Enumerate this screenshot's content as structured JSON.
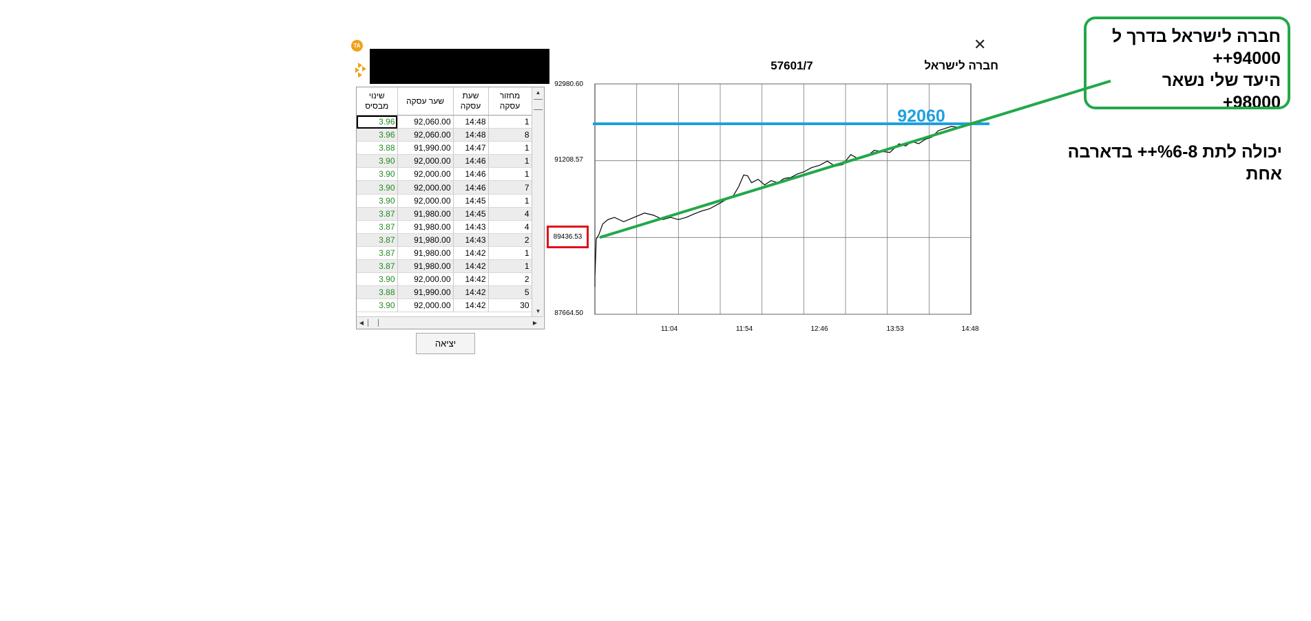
{
  "header": {
    "logo_text": "TA",
    "security_number": "57601/7",
    "security_name": "חברה לישראל",
    "close_symbol": "✕"
  },
  "table": {
    "columns": [
      "מחזור עסקה",
      "שעת עסקה",
      "שער עסקה",
      "שינוי מבסיס"
    ],
    "rows": [
      {
        "volume": "1",
        "time": "14:48",
        "price": "92,060.00",
        "change": "3.96"
      },
      {
        "volume": "8",
        "time": "14:48",
        "price": "92,060.00",
        "change": "3.96"
      },
      {
        "volume": "1",
        "time": "14:47",
        "price": "91,990.00",
        "change": "3.88"
      },
      {
        "volume": "1",
        "time": "14:46",
        "price": "92,000.00",
        "change": "3.90"
      },
      {
        "volume": "1",
        "time": "14:46",
        "price": "92,000.00",
        "change": "3.90"
      },
      {
        "volume": "7",
        "time": "14:46",
        "price": "92,000.00",
        "change": "3.90"
      },
      {
        "volume": "1",
        "time": "14:45",
        "price": "92,000.00",
        "change": "3.90"
      },
      {
        "volume": "4",
        "time": "14:45",
        "price": "91,980.00",
        "change": "3.87"
      },
      {
        "volume": "4",
        "time": "14:43",
        "price": "91,980.00",
        "change": "3.87"
      },
      {
        "volume": "2",
        "time": "14:43",
        "price": "91,980.00",
        "change": "3.87"
      },
      {
        "volume": "1",
        "time": "14:42",
        "price": "91,980.00",
        "change": "3.87"
      },
      {
        "volume": "1",
        "time": "14:42",
        "price": "91,980.00",
        "change": "3.87"
      },
      {
        "volume": "2",
        "time": "14:42",
        "price": "92,000.00",
        "change": "3.90"
      },
      {
        "volume": "5",
        "time": "14:42",
        "price": "91,990.00",
        "change": "3.88"
      },
      {
        "volume": "30",
        "time": "14:42",
        "price": "92,000.00",
        "change": "3.90"
      }
    ],
    "exit_label": "יציאה"
  },
  "annotations": {
    "box_lines": [
      "חברה לישראל בדרך ל",
      "94000++",
      "היעד שלי נשאר",
      "98000+"
    ],
    "note_lines": [
      "יכולה לתת %6-8++ בדארבה",
      "אחת"
    ],
    "blue_label": "92060",
    "colors": {
      "green": "#22a84a",
      "blue": "#1fa0de",
      "red": "#e0101a",
      "change_text": "#1e8a1e"
    }
  },
  "chart_data": {
    "type": "line",
    "title": "",
    "xlabel": "",
    "ylabel": "",
    "ylim": [
      87664.5,
      92980.6
    ],
    "y_ticks": [
      "92980.60",
      "91208.57",
      "89436.53",
      "87664.50"
    ],
    "x_ticks": [
      "11:04",
      "11:54",
      "12:46",
      "13:53",
      "14:48"
    ],
    "xlim": [
      "10:00",
      "14:48"
    ],
    "grid": true,
    "series": [
      {
        "x": [
          "10:00",
          "10:01",
          "10:03",
          "10:06",
          "10:10",
          "10:15",
          "10:22",
          "10:30",
          "10:38",
          "10:45",
          "10:52",
          "10:58",
          "11:04",
          "11:10",
          "11:16",
          "11:22",
          "11:28",
          "11:34",
          "11:40",
          "11:46",
          "11:50",
          "11:54",
          "11:57",
          "12:00",
          "12:05",
          "12:10",
          "12:15",
          "12:20",
          "12:25",
          "12:30",
          "12:35",
          "12:40",
          "12:46",
          "12:52",
          "12:58",
          "13:04",
          "13:10",
          "13:16",
          "13:22",
          "13:28",
          "13:34",
          "13:40",
          "13:46",
          "13:53",
          "13:58",
          "14:03",
          "14:08",
          "14:13",
          "14:18",
          "14:23",
          "14:28",
          "14:33",
          "14:38",
          "14:43",
          "14:48"
        ],
        "values": [
          88500,
          89400,
          89500,
          89750,
          89850,
          89900,
          89800,
          89900,
          90000,
          89950,
          89850,
          89900,
          89850,
          89900,
          89980,
          90050,
          90100,
          90200,
          90300,
          90400,
          90600,
          90880,
          90860,
          90700,
          90780,
          90650,
          90750,
          90700,
          90800,
          90820,
          90900,
          90950,
          91050,
          91100,
          91200,
          91080,
          91120,
          91350,
          91250,
          91300,
          91450,
          91420,
          91400,
          91600,
          91550,
          91650,
          91600,
          91700,
          91750,
          91900,
          91950,
          92000,
          91980,
          92000,
          92060
        ]
      }
    ],
    "overlays": {
      "horizontal_line": 92060,
      "trend_line": [
        89436.53,
        92060
      ]
    }
  }
}
